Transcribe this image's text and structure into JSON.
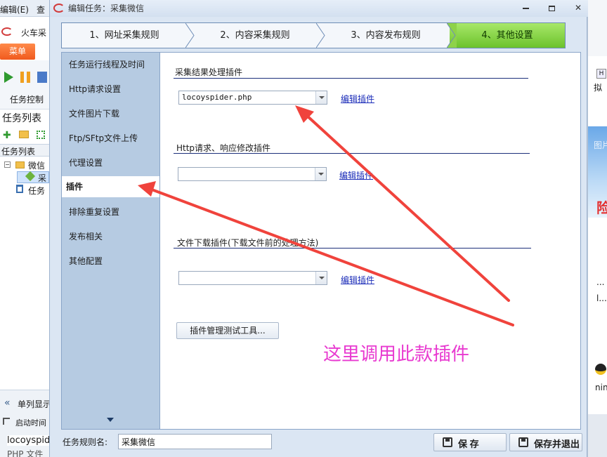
{
  "background_app": {
    "menu_edit": "编辑(E)",
    "menu_query": "查",
    "title": "火车采",
    "menu_tab": "菜单",
    "task_control": "任务控制",
    "task_list_table": "任务列表",
    "tree_header": "任务列表",
    "tree_folder_label": "微信",
    "tree_selected_label": "采",
    "tree_task_label": "任务",
    "single_column": "单列显示",
    "start_time": "启动时间",
    "file_name": "locoyspid",
    "file_type": "PHP 文件"
  },
  "background_right": {
    "h_label": "H",
    "ni_label": "拟",
    "img_label": "图片",
    "exclaim_label": "险！",
    "dot_label": "...",
    "l_dot_label": "l...",
    "ning_label": "ning"
  },
  "dialog": {
    "title": "编辑任务：采集微信",
    "steps": [
      {
        "label": "1、网址采集规则"
      },
      {
        "label": "2、内容采集规则"
      },
      {
        "label": "3、内容发布规则"
      },
      {
        "label": "4、其他设置"
      }
    ],
    "sidebar": {
      "items": [
        {
          "label": "任务运行线程及时间"
        },
        {
          "label": "Http请求设置"
        },
        {
          "label": "文件图片下载"
        },
        {
          "label": "Ftp/SFtp文件上传"
        },
        {
          "label": "代理设置"
        },
        {
          "label": "插件"
        },
        {
          "label": "排除重复设置"
        },
        {
          "label": "发布相关"
        },
        {
          "label": "其他配置"
        }
      ],
      "active_index": 5
    },
    "sections": [
      {
        "title": "采集结果处理插件",
        "value": "locoyspider.php",
        "link": "编辑插件"
      },
      {
        "title": "Http请求、响应修改插件",
        "value": "",
        "link": "编辑插件"
      },
      {
        "title": "文件下载插件(下载文件前的处理方法)",
        "value": "",
        "link": "编辑插件"
      }
    ],
    "plugin_test_button": "插件管理测试工具...",
    "annotation": "这里调用此款插件",
    "annotation_color": "#e83ad0",
    "arrow_color": "#f0433c",
    "accent_green": "#6cc22c",
    "footer": {
      "task_name_label": "任务规则名:",
      "task_name_value": "采集微信",
      "save_label": "保 存",
      "save_exit_label": "保存并退出"
    }
  }
}
